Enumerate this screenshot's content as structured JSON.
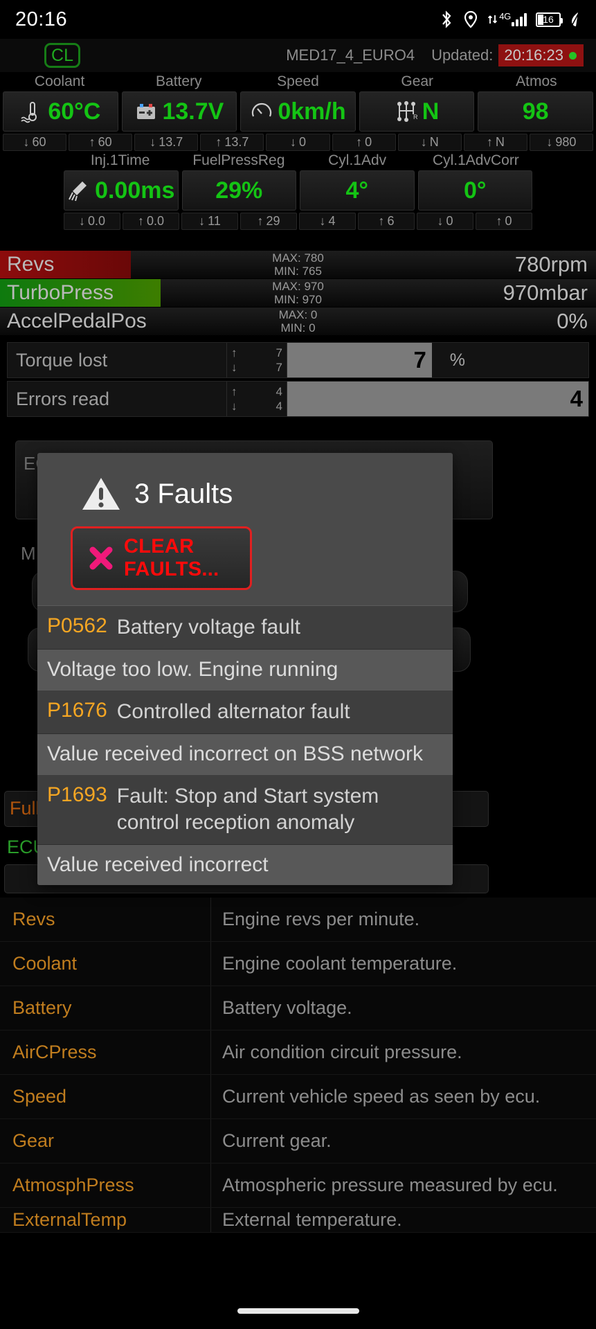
{
  "status_bar": {
    "clock": "20:16",
    "icons": [
      "bluetooth-icon",
      "location-icon",
      "mobile-data-icon",
      "signal-icon",
      "battery-icon"
    ],
    "network_type": "4G",
    "battery_level": "16"
  },
  "app_header": {
    "connection_badge": "CL",
    "ecu_name": "MED17_4_EURO4",
    "updated_label": "Updated:",
    "updated_time": "20:16:23"
  },
  "gauges_row1": {
    "labels": [
      "Coolant",
      "Battery",
      "Speed",
      "Gear",
      "Atmos"
    ],
    "values": [
      "60°C",
      "13.7V",
      "0km/h",
      "N",
      "98"
    ],
    "icons": [
      "thermometer-icon",
      "battery-cell-icon",
      "speedometer-icon",
      "gearstick-icon",
      ""
    ],
    "minmax": [
      {
        "down": "60",
        "up": "60"
      },
      {
        "down": "13.7",
        "up": "13.7"
      },
      {
        "down": "0",
        "up": "0"
      },
      {
        "down": "N",
        "up": "N"
      },
      {
        "down": "980",
        "up": ""
      }
    ]
  },
  "gauges_row2": {
    "labels": [
      "Inj.1Time",
      "FuelPressReg",
      "Cyl.1Adv",
      "Cyl.1AdvCorr"
    ],
    "values": [
      "0.00ms",
      "29%",
      "4°",
      "0°"
    ],
    "icons": [
      "injector-icon",
      "",
      "",
      ""
    ],
    "minmax": [
      {
        "down": "0.0",
        "up": "0.0"
      },
      {
        "down": "11",
        "up": "29"
      },
      {
        "down": "4",
        "up": "6"
      },
      {
        "down": "0",
        "up": "0"
      }
    ]
  },
  "bar_gauges": [
    {
      "name": "Revs",
      "max": "MAX: 780",
      "min": "MIN: 765",
      "value": "780rpm",
      "fill_pct": 22,
      "fill_color": "#8c0c0c"
    },
    {
      "name": "TurboPress",
      "max": "MAX: 970",
      "min": "MIN: 970",
      "value": "970mbar",
      "fill_pct": 32,
      "fill_color": "#1d8c0d"
    },
    {
      "name": "AccelPedalPos",
      "max": "MAX: 0",
      "min": "MIN: 0",
      "value": "0%",
      "fill_pct": 0,
      "fill_color": "#555555"
    }
  ],
  "counters": [
    {
      "name": "Torque lost",
      "up": "7",
      "down": "7",
      "value": "7",
      "unit": "%",
      "bar_pct": 48
    },
    {
      "name": "Errors read",
      "up": "4",
      "down": "4",
      "value": "4",
      "unit": "",
      "bar_pct": 100
    }
  ],
  "background": {
    "ecu_label": "EC",
    "m_label": "M",
    "full_label": "Full",
    "ecu_text": "ECU"
  },
  "dialog": {
    "title": "3 Faults",
    "warning_icon": "warning-triangle-icon",
    "clear_button_label": "CLEAR FAULTS...",
    "clear_button_icon": "cross-icon",
    "faults": [
      {
        "code": "P0562",
        "name": "Battery voltage fault",
        "description": "Voltage too low. Engine running"
      },
      {
        "code": "P1676",
        "name": "Controlled alternator fault",
        "description": "Value received incorrect on BSS network"
      },
      {
        "code": "P1693",
        "name": "Fault: Stop and Start system control reception anomaly",
        "description": "Value received incorrect"
      }
    ]
  },
  "info_table": [
    {
      "key": "Revs",
      "value": "Engine revs per minute."
    },
    {
      "key": "Coolant",
      "value": "Engine coolant temperature."
    },
    {
      "key": "Battery",
      "value": "Battery voltage."
    },
    {
      "key": "AirCPress",
      "value": "Air condition circuit pressure."
    },
    {
      "key": "Speed",
      "value": "Current vehicle speed as seen by ecu."
    },
    {
      "key": "Gear",
      "value": "Current gear."
    },
    {
      "key": "AtmosphPress",
      "value": "Atmospheric pressure measured by ecu."
    },
    {
      "key": "ExternalTemp",
      "value": "External temperature."
    }
  ],
  "colors": {
    "green_value": "#14c414",
    "orange_key": "#c07d1e",
    "fault_code": "#f5a623",
    "alert_red": "#ff0b0b",
    "header_red": "#8e1111"
  }
}
